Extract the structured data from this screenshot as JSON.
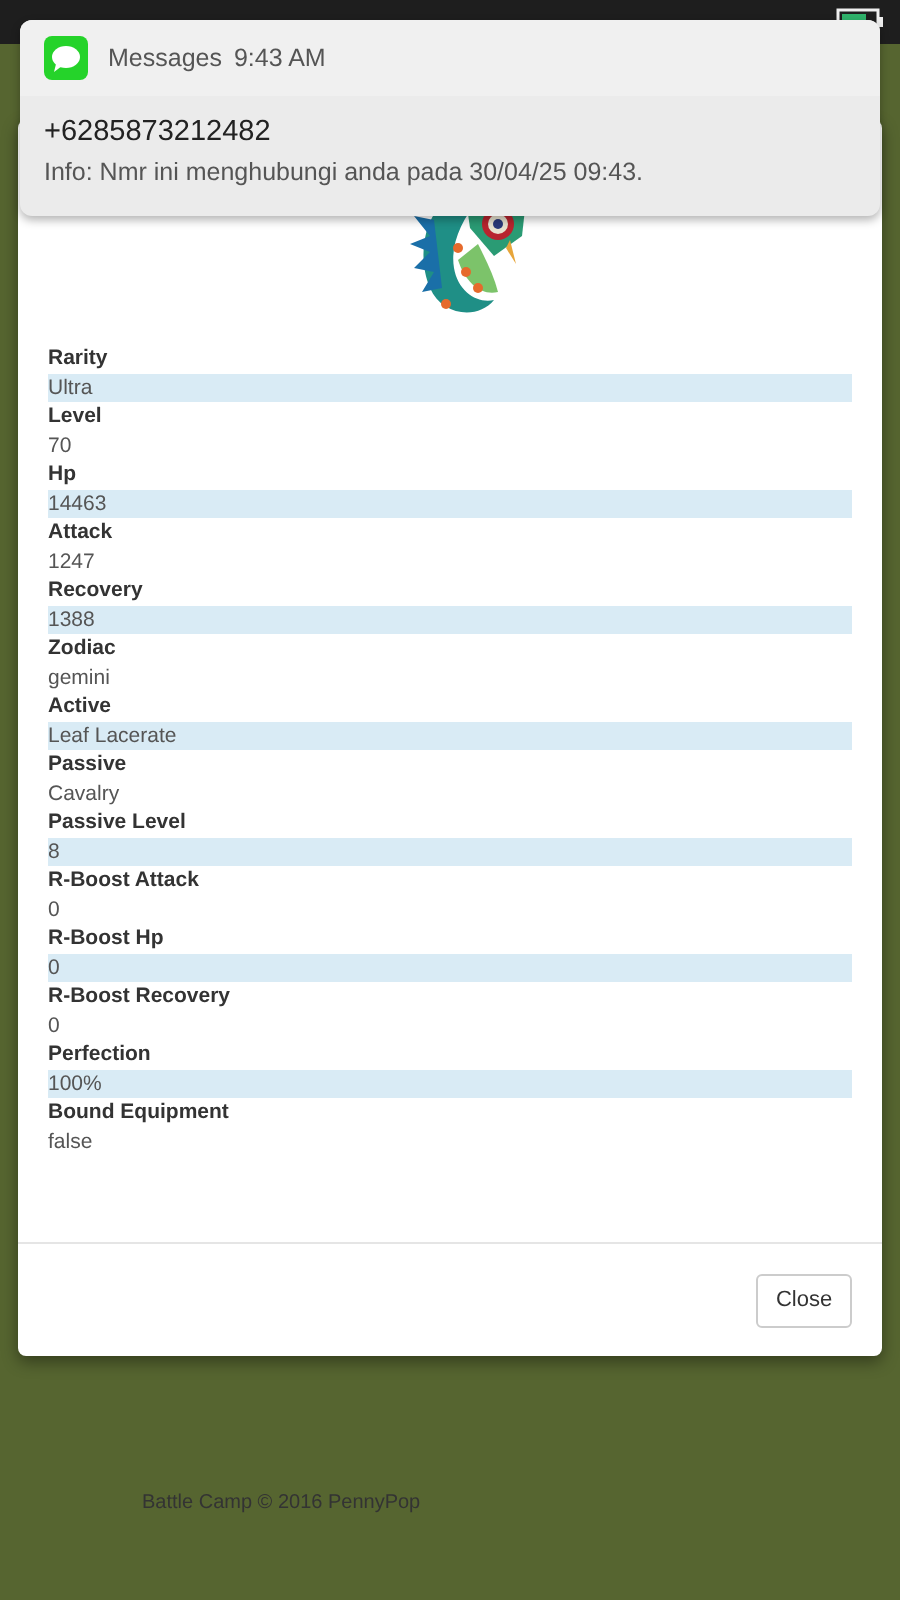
{
  "notification": {
    "app": "Messages",
    "time": "9:43 AM",
    "sender": "+6285873212482",
    "message": "Info: Nmr ini menghubungi anda pada 30/04/25 09:43."
  },
  "stats": [
    {
      "label": "Rarity",
      "value": "Ultra"
    },
    {
      "label": "Level",
      "value": "70"
    },
    {
      "label": "Hp",
      "value": "14463"
    },
    {
      "label": "Attack",
      "value": "1247"
    },
    {
      "label": "Recovery",
      "value": "1388"
    },
    {
      "label": "Zodiac",
      "value": "gemini"
    },
    {
      "label": "Active",
      "value": "Leaf Lacerate"
    },
    {
      "label": "Passive",
      "value": "Cavalry"
    },
    {
      "label": "Passive Level",
      "value": "8"
    },
    {
      "label": "R-Boost Attack",
      "value": "0"
    },
    {
      "label": "R-Boost Hp",
      "value": "0"
    },
    {
      "label": "R-Boost Recovery",
      "value": "0"
    },
    {
      "label": "Perfection",
      "value": "100%"
    },
    {
      "label": "Bound Equipment",
      "value": "false"
    }
  ],
  "buttons": [
    "Close"
  ],
  "footer": "Battle Camp © 2016 PennyPop"
}
